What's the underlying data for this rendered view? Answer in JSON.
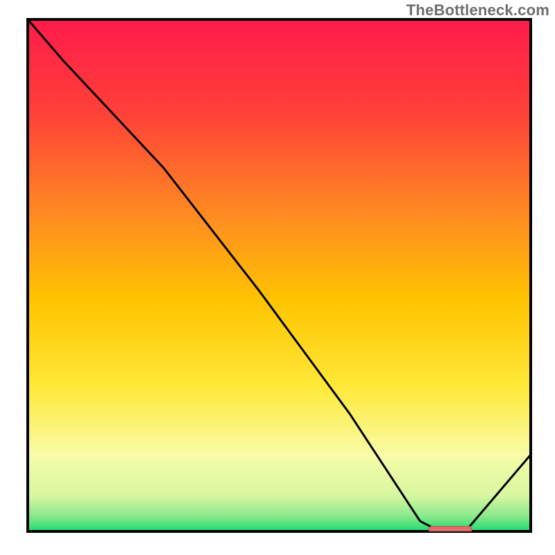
{
  "watermark": "TheBottleneck.com",
  "chart_data": {
    "type": "line",
    "title": "",
    "xlabel": "",
    "ylabel": "",
    "x": [
      0.0,
      0.07,
      0.27,
      0.46,
      0.64,
      0.78,
      0.82,
      0.87,
      1.0
    ],
    "values": [
      1.0,
      0.92,
      0.71,
      0.47,
      0.23,
      0.02,
      0.0,
      0.0,
      0.15
    ],
    "xlim": [
      0,
      1
    ],
    "ylim": [
      0,
      1
    ],
    "background_gradient": {
      "top": "#ff1b4b",
      "upper_mid": "#ff7a2a",
      "mid": "#ffd400",
      "lower_mid": "#f7f99a",
      "bottom": "#1fd86f"
    },
    "marker_bar": {
      "x_center": 0.84,
      "y": 0.003,
      "width": 0.085,
      "color": "#e26b6b"
    }
  }
}
